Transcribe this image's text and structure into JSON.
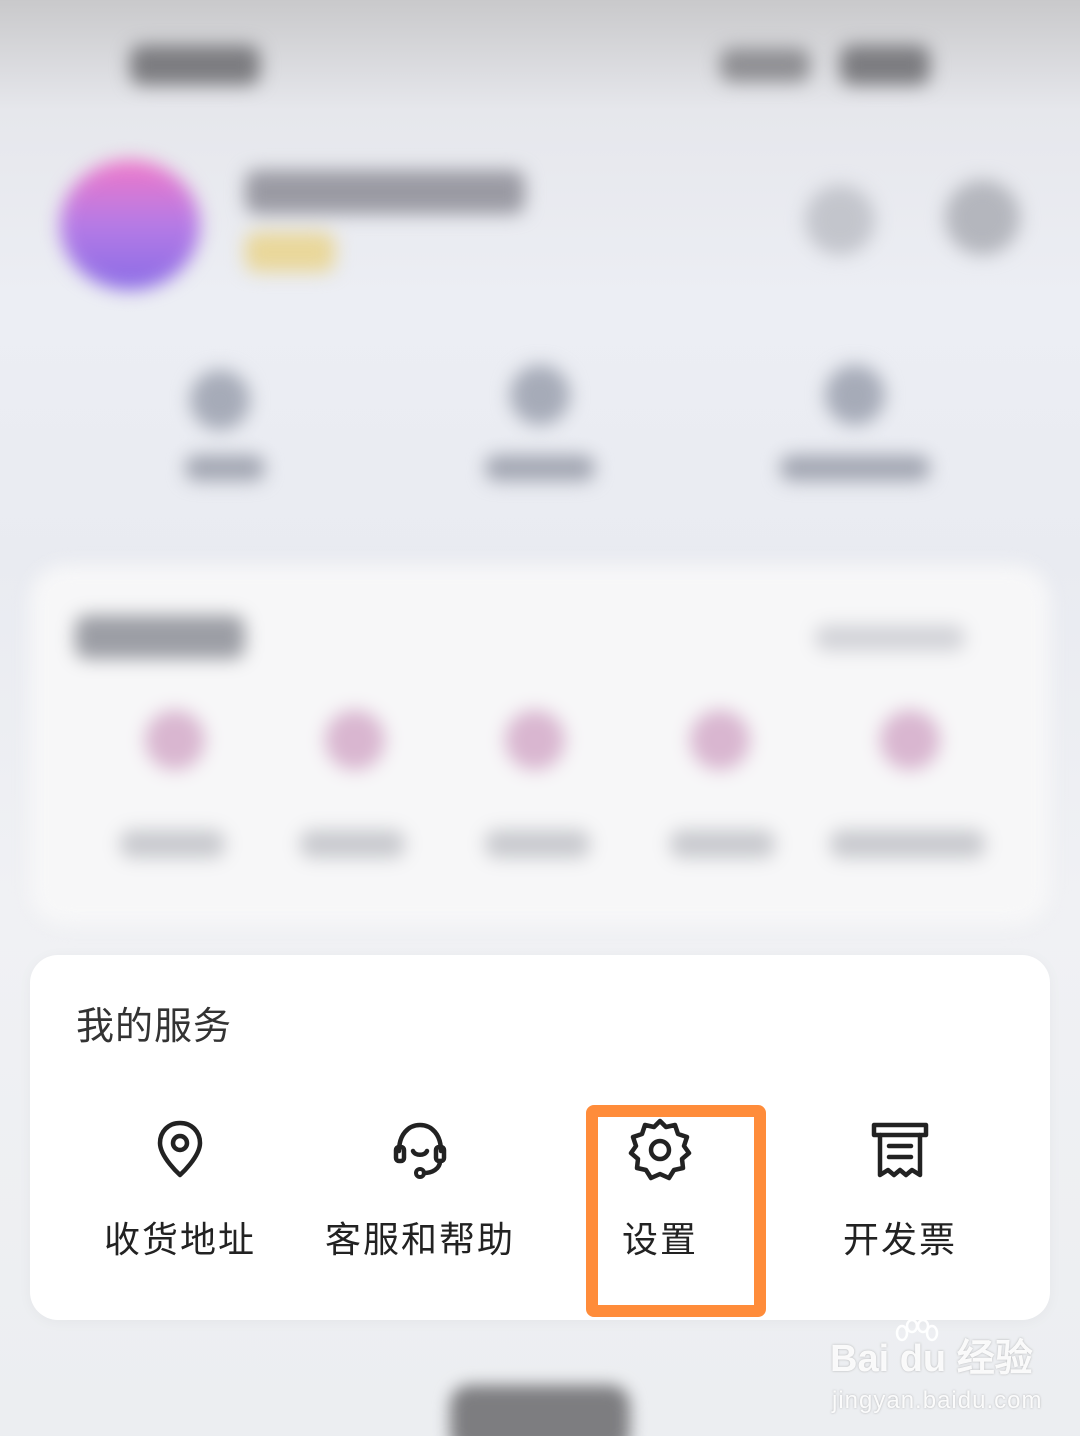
{
  "services": {
    "title": "我的服务",
    "items": [
      {
        "label": "收货地址",
        "icon": "location-pin-icon"
      },
      {
        "label": "客服和帮助",
        "icon": "headset-icon"
      },
      {
        "label": "设置",
        "icon": "gear-icon"
      },
      {
        "label": "开发票",
        "icon": "receipt-icon"
      }
    ],
    "highlighted_item": "设置"
  },
  "colors": {
    "highlight": "#ff8c3a",
    "card_background": "#ffffff",
    "text": "#222222"
  },
  "watermark": {
    "brand": "Bai du",
    "suffix": "经验",
    "url": "jingyan.baidu.com"
  }
}
